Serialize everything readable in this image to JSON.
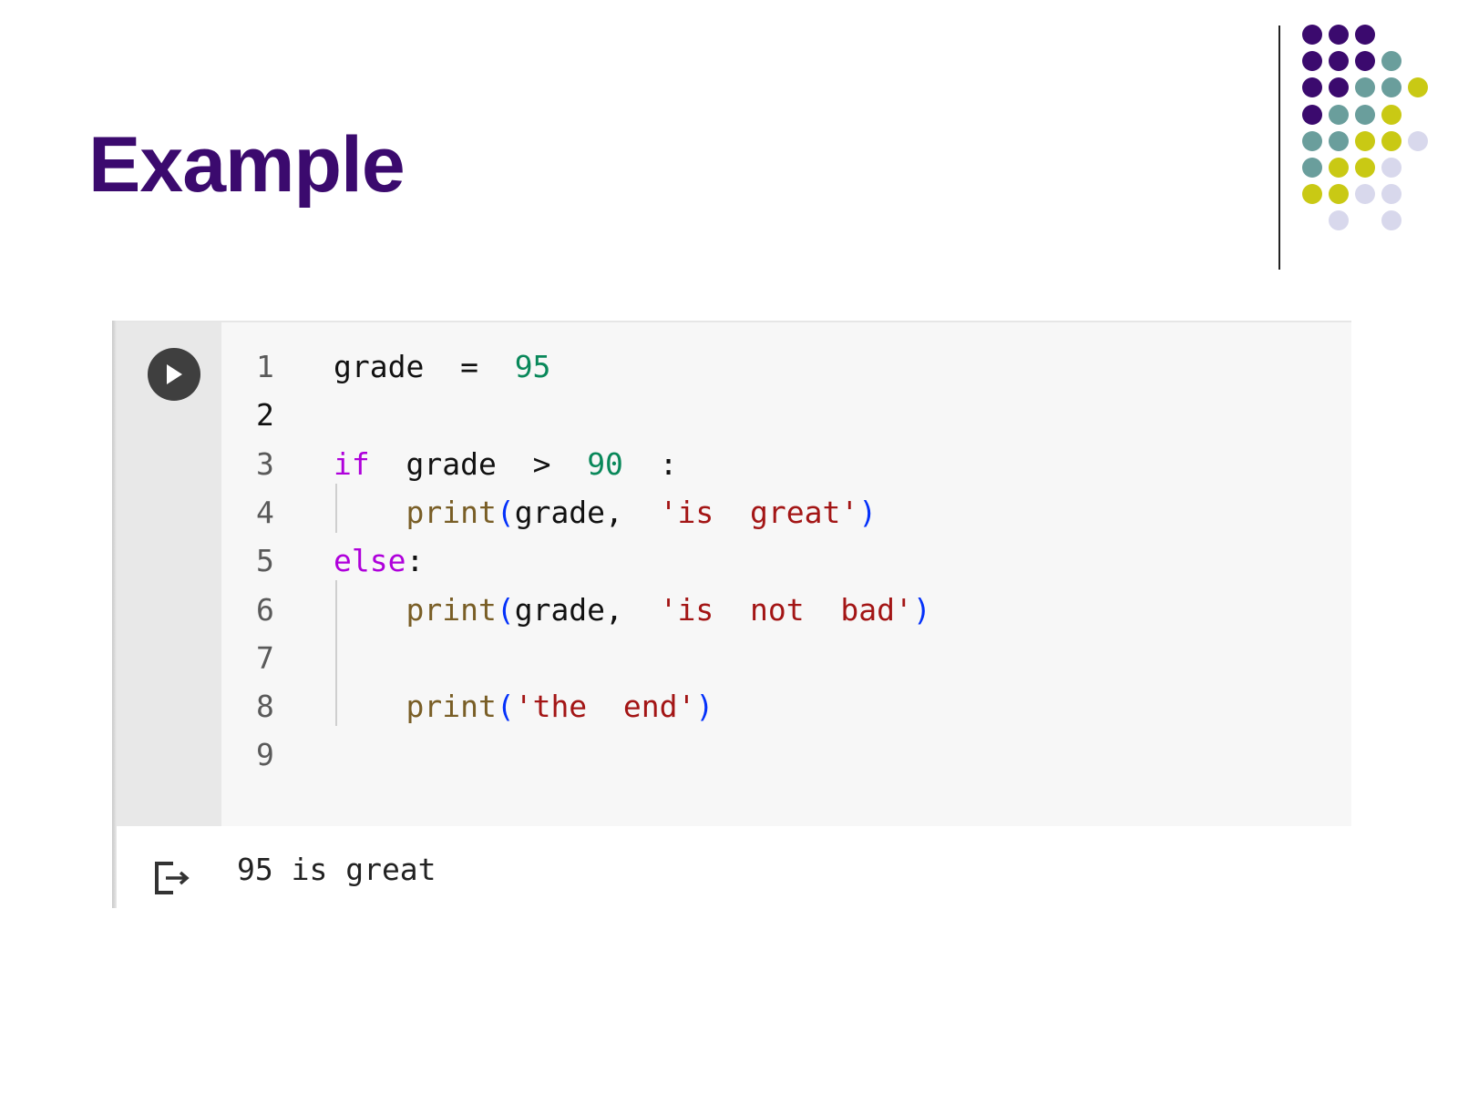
{
  "slide": {
    "title": "Example"
  },
  "decor": {
    "dot_colors": {
      "purple": "#3b0a6e",
      "teal": "#6a9e9c",
      "yellow": "#c9c914",
      "lavender": "#d8d8ec"
    }
  },
  "cell": {
    "run_button_icon": "play-icon",
    "lines": [
      {
        "n": "1",
        "tokens": [
          [
            "var",
            "grade"
          ],
          [
            "op",
            "  =  "
          ],
          [
            "num",
            "95"
          ]
        ]
      },
      {
        "n": "2",
        "tokens": []
      },
      {
        "n": "3",
        "tokens": [
          [
            "kw",
            "if"
          ],
          [
            "var",
            "  grade  "
          ],
          [
            "op",
            ">"
          ],
          [
            "op",
            "  "
          ],
          [
            "num",
            "90"
          ],
          [
            "op",
            "  :"
          ]
        ]
      },
      {
        "n": "4",
        "tokens": [
          [
            "var",
            "    "
          ],
          [
            "fn",
            "print"
          ],
          [
            "paren",
            "("
          ],
          [
            "var",
            "grade,  "
          ],
          [
            "str",
            "'is  great'"
          ],
          [
            "paren",
            ")"
          ]
        ]
      },
      {
        "n": "5",
        "tokens": [
          [
            "kw",
            "else"
          ],
          [
            "op",
            ":"
          ]
        ]
      },
      {
        "n": "6",
        "tokens": [
          [
            "var",
            "    "
          ],
          [
            "fn",
            "print"
          ],
          [
            "paren",
            "("
          ],
          [
            "var",
            "grade,  "
          ],
          [
            "str",
            "'is  not  bad'"
          ],
          [
            "paren",
            ")"
          ]
        ]
      },
      {
        "n": "7",
        "tokens": []
      },
      {
        "n": "8",
        "tokens": [
          [
            "var",
            "    "
          ],
          [
            "fn",
            "print"
          ],
          [
            "paren",
            "("
          ],
          [
            "str",
            "'the  end'"
          ],
          [
            "paren",
            ")"
          ]
        ]
      },
      {
        "n": "9",
        "tokens": []
      }
    ],
    "output_icon": "output-arrow-icon",
    "output": "95 is great"
  }
}
